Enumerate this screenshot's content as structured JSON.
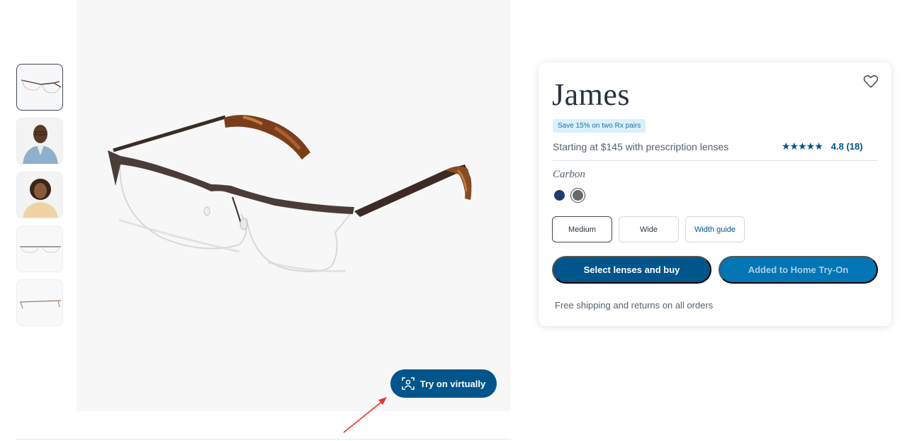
{
  "gallery": {
    "thumbnails": [
      {
        "name": "thumb-glasses-angle"
      },
      {
        "name": "thumb-model-man"
      },
      {
        "name": "thumb-model-woman"
      },
      {
        "name": "thumb-glasses-front"
      },
      {
        "name": "thumb-glasses-side"
      }
    ],
    "try_on_label": "Try on virtually"
  },
  "product": {
    "name": "James",
    "promo_badge": "Save 15% on two Rx pairs",
    "price_text": "Starting at $145 with prescription lenses",
    "rating_stars": "★★★★★",
    "rating_text": "4.8 (18)",
    "rating_value": 4.8,
    "review_count": 18,
    "color_label": "Carbon",
    "swatches": [
      {
        "name": "navy",
        "hex": "#233c6b"
      },
      {
        "name": "carbon",
        "hex": "#6a6a6a",
        "selected": true
      }
    ],
    "sizes": [
      "Medium",
      "Wide"
    ],
    "size_selected": "Medium",
    "width_guide_label": "Width guide",
    "buy_label": "Select lenses and buy",
    "hto_label": "Added to Home Try-On",
    "shipping_text": "Free shipping and returns on all orders"
  },
  "colors": {
    "brand_blue": "#00558a",
    "secondary_blue": "#0275b5",
    "annotation_arrow": "#e8322a"
  }
}
